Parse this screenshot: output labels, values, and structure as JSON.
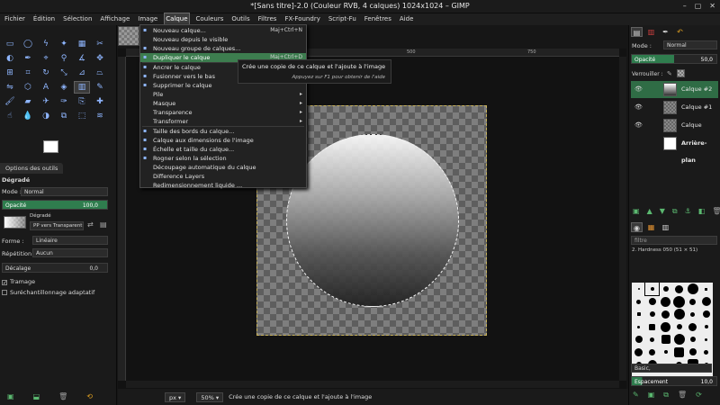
{
  "window": {
    "title": "*[Sans titre]-2.0 (Couleur RVB, 4 calques) 1024x1024 – GIMP",
    "controls": [
      "–",
      "▢",
      "✕"
    ]
  },
  "menubar": [
    {
      "label": "Fichier"
    },
    {
      "label": "Édition"
    },
    {
      "label": "Sélection"
    },
    {
      "label": "Affichage"
    },
    {
      "label": "Image"
    },
    {
      "label": "Calque",
      "active": true
    },
    {
      "label": "Couleurs"
    },
    {
      "label": "Outils"
    },
    {
      "label": "Filtres"
    },
    {
      "label": "FX-Foundry"
    },
    {
      "label": "Script-Fu"
    },
    {
      "label": "Fenêtres"
    },
    {
      "label": "Aide"
    }
  ],
  "layer_menu": [
    {
      "label": "Nouveau calque...",
      "accel": "Maj+Ctrl+N",
      "icon": "new-layer-icon"
    },
    {
      "label": "Nouveau depuis le visible",
      "accel": "",
      "icon": ""
    },
    {
      "label": "Nouveau groupe de calques...",
      "accel": "",
      "icon": "new-group-icon"
    },
    {
      "label": "Dupliquer le calque",
      "accel": "Maj+Ctrl+D",
      "icon": "duplicate-layer-icon",
      "highlight": true
    },
    {
      "label": "Ancrer le calque",
      "accel": "",
      "icon": "anchor-icon"
    },
    {
      "label": "Fusionner vers le bas",
      "accel": "",
      "icon": "merge-down-icon"
    },
    {
      "label": "Supprimer le calque",
      "accel": "",
      "icon": "delete-layer-icon"
    },
    {
      "label": "Pile",
      "accel": "▸",
      "icon": ""
    },
    {
      "label": "Masque",
      "accel": "▸",
      "icon": ""
    },
    {
      "label": "Transparence",
      "accel": "▸",
      "icon": ""
    },
    {
      "label": "Transformer",
      "accel": "▸",
      "icon": ""
    },
    {
      "label": "Taille des bords du calque...",
      "accel": "",
      "icon": "layer-boundary-icon"
    },
    {
      "label": "Calque aux dimensions de l'image",
      "accel": "",
      "icon": "layer-to-image-icon"
    },
    {
      "label": "Échelle et taille du calque...",
      "accel": "",
      "icon": "scale-layer-icon"
    },
    {
      "label": "Rogner selon la sélection",
      "accel": "",
      "icon": "crop-icon"
    },
    {
      "label": "Découpage automatique du calque",
      "accel": "",
      "icon": ""
    },
    {
      "label": "Difference Layers",
      "accel": "",
      "icon": ""
    },
    {
      "label": "Redimensionnement liquide ...",
      "accel": "",
      "icon": ""
    }
  ],
  "tooltip": {
    "main": "Crée une copie de ce calque et l'ajoute à l'image",
    "help": "Appuyez sur F1 pour obtenir de l'aide"
  },
  "tool_options": {
    "tab": "Options des outils",
    "tool_name": "Dégradé",
    "mode_label": "Mode :",
    "mode_value": "Normal",
    "opacity_label": "Opacité",
    "opacity_value": "100,0",
    "gradient_label": "Dégradé",
    "gradient_value": "PP vers Transparent",
    "shape_label": "Forme :",
    "shape_value": "Linéaire",
    "repeat_label": "Répétition :",
    "repeat_value": "Aucun",
    "offset_label": "Décalage",
    "offset_value": "0,0",
    "dither_label": "Tramage",
    "adaptive_label": "Suréchantillonnage adaptatif"
  },
  "status": {
    "unit": "px",
    "zoom": "50%",
    "message": "Crée une copie de ce calque et l'ajoute à l'image"
  },
  "ruler": {
    "ticks": [
      "250",
      "500",
      "750",
      "1000"
    ]
  },
  "layers_panel": {
    "mode_label": "Mode :",
    "mode_value": "Normal",
    "opacity_label": "Opacité",
    "opacity_value": "50,0",
    "lock_label": "Verrouiller :",
    "layers": [
      {
        "name": "Calque #2",
        "selected": true
      },
      {
        "name": "Calque #1",
        "selected": false
      },
      {
        "name": "Calque",
        "selected": false
      },
      {
        "name": "Arrière-plan",
        "selected": false
      }
    ]
  },
  "brushes_panel": {
    "filter": "filtre",
    "brush_name": "2. Hardness 050 (51 × 51)",
    "category": "Basic,",
    "spacing_label": "Espacement",
    "spacing_value": "10,0"
  },
  "colors": {
    "accent": "#3d7d4f",
    "foreground": "#ffffff",
    "background": "#000000"
  }
}
